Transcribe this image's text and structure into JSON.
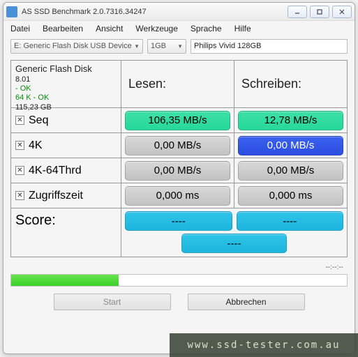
{
  "window": {
    "title": "AS SSD Benchmark 2.0.7316.34247"
  },
  "menu": [
    "Datei",
    "Bearbeiten",
    "Ansicht",
    "Werkzeuge",
    "Sprache",
    "Hilfe"
  ],
  "toolbar": {
    "device": "E: Generic Flash Disk USB Device",
    "size": "1GB",
    "name": "Philips Vivid 128GB"
  },
  "info": {
    "name": "Generic Flash Disk",
    "firmware": "8.01",
    "status1": " - OK",
    "status2": "64 K - OK",
    "capacity": "115,23 GB"
  },
  "headers": {
    "read": "Lesen:",
    "write": "Schreiben:"
  },
  "rows": [
    {
      "label": "Seq",
      "read": "106,35 MB/s",
      "readClass": "green",
      "write": "12,78 MB/s",
      "writeClass": "green"
    },
    {
      "label": "4K",
      "read": "0,00 MB/s",
      "readClass": "gray",
      "write": "0,00 MB/s",
      "writeClass": "blue"
    },
    {
      "label": "4K-64Thrd",
      "read": "0,00 MB/s",
      "readClass": "gray",
      "write": "0,00 MB/s",
      "writeClass": "gray"
    },
    {
      "label": "Zugriffszeit",
      "read": "0,000 ms",
      "readClass": "gray",
      "write": "0,000 ms",
      "writeClass": "gray"
    }
  ],
  "score": {
    "label": "Score:",
    "read": "----",
    "write": "----",
    "total": "----"
  },
  "status": "--:--:--",
  "progress_pct": 32,
  "buttons": {
    "start": "Start",
    "abort": "Abbrechen"
  },
  "watermark": "www.ssd-tester.com.au"
}
